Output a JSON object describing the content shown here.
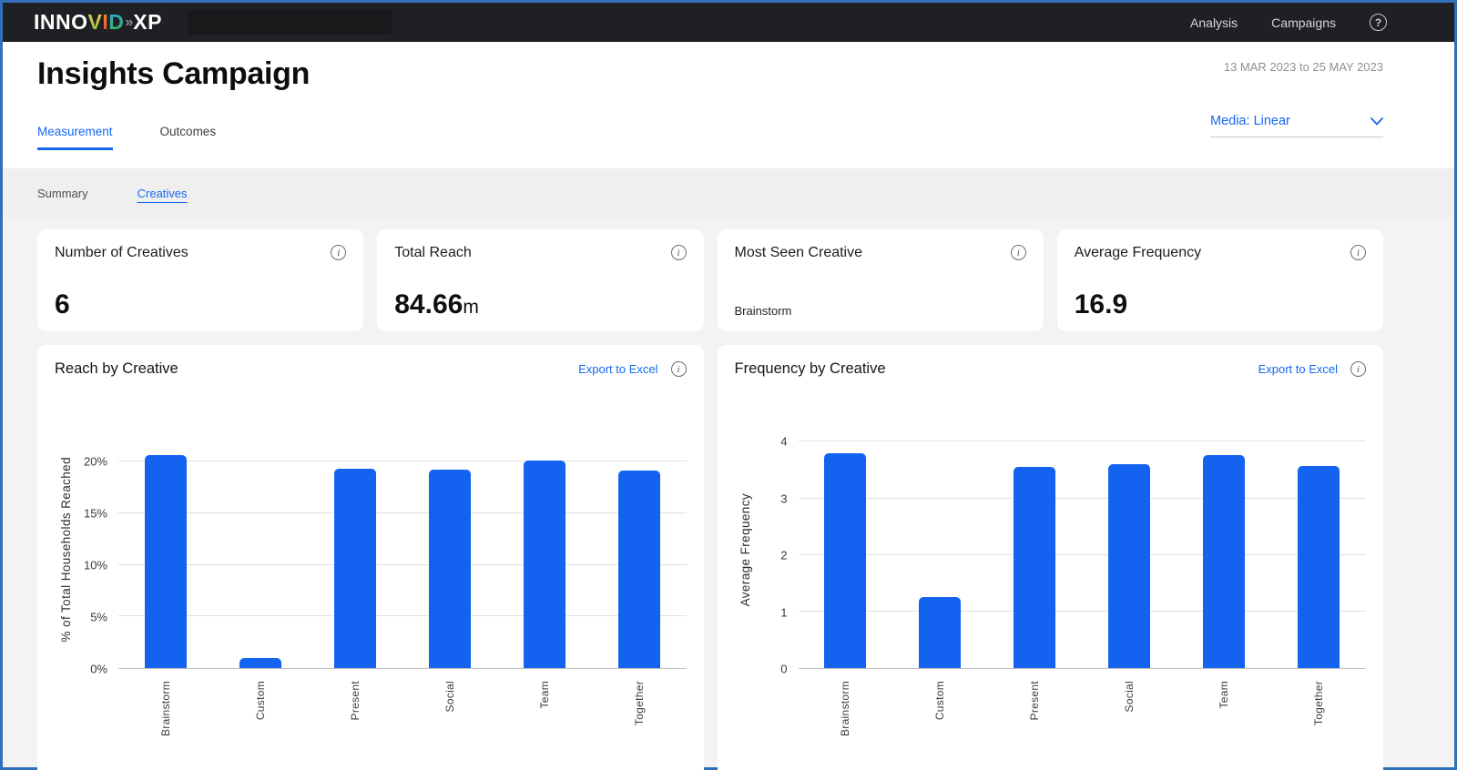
{
  "colors": {
    "accent": "#1567F2",
    "nav_bg": "#1E2023",
    "bar": "#1463F0"
  },
  "nav": {
    "logo": {
      "part1": "INNO",
      "v": "V",
      "i": "I",
      "d": "D",
      "sep": "»",
      "part2": "XP"
    },
    "links": [
      {
        "label": "Analysis"
      },
      {
        "label": "Campaigns"
      }
    ],
    "help_label": "?"
  },
  "header": {
    "title": "Insights Campaign",
    "date_range": "13 MAR 2023 to 25 MAY 2023",
    "tabs": [
      {
        "label": "Measurement",
        "active": true
      },
      {
        "label": "Outcomes",
        "active": false
      }
    ],
    "media_filter": {
      "label": "Media:",
      "value": "Linear"
    }
  },
  "subtabs": [
    {
      "label": "Summary",
      "active": false
    },
    {
      "label": "Creatives",
      "active": true
    }
  ],
  "kpis": [
    {
      "title": "Number of Creatives",
      "value": "6",
      "suffix": ""
    },
    {
      "title": "Total Reach",
      "value": "84.66",
      "suffix": "m"
    },
    {
      "title": "Most Seen Creative",
      "value": "Brainstorm",
      "suffix": ""
    },
    {
      "title": "Average Frequency",
      "value": "16.9",
      "suffix": ""
    }
  ],
  "chart_data": [
    {
      "type": "bar",
      "title": "Reach by Creative",
      "export_label": "Export to Excel",
      "categories": [
        "Brainstorm",
        "Custom",
        "Present",
        "Social",
        "Team",
        "Together"
      ],
      "values": [
        20.6,
        1.0,
        19.3,
        19.2,
        20.1,
        19.1
      ],
      "xlabel": "",
      "ylabel": "% of Total Households Reached",
      "yticks": [
        0,
        5,
        10,
        15,
        20
      ],
      "ytick_format": "percent",
      "ylim": [
        0,
        23
      ],
      "grid": true,
      "legend": false,
      "bar_color": "#1463F0"
    },
    {
      "type": "bar",
      "title": "Frequency by Creative",
      "export_label": "Export to Excel",
      "categories": [
        "Brainstorm",
        "Custom",
        "Present",
        "Social",
        "Team",
        "Together"
      ],
      "values": [
        3.8,
        1.26,
        3.55,
        3.6,
        3.77,
        3.58
      ],
      "xlabel": "",
      "ylabel": "Average Frequency",
      "yticks": [
        0,
        1,
        2,
        3,
        4
      ],
      "ytick_format": "number",
      "ylim": [
        0,
        4.2
      ],
      "grid": true,
      "legend": false,
      "bar_color": "#1463F0"
    }
  ]
}
